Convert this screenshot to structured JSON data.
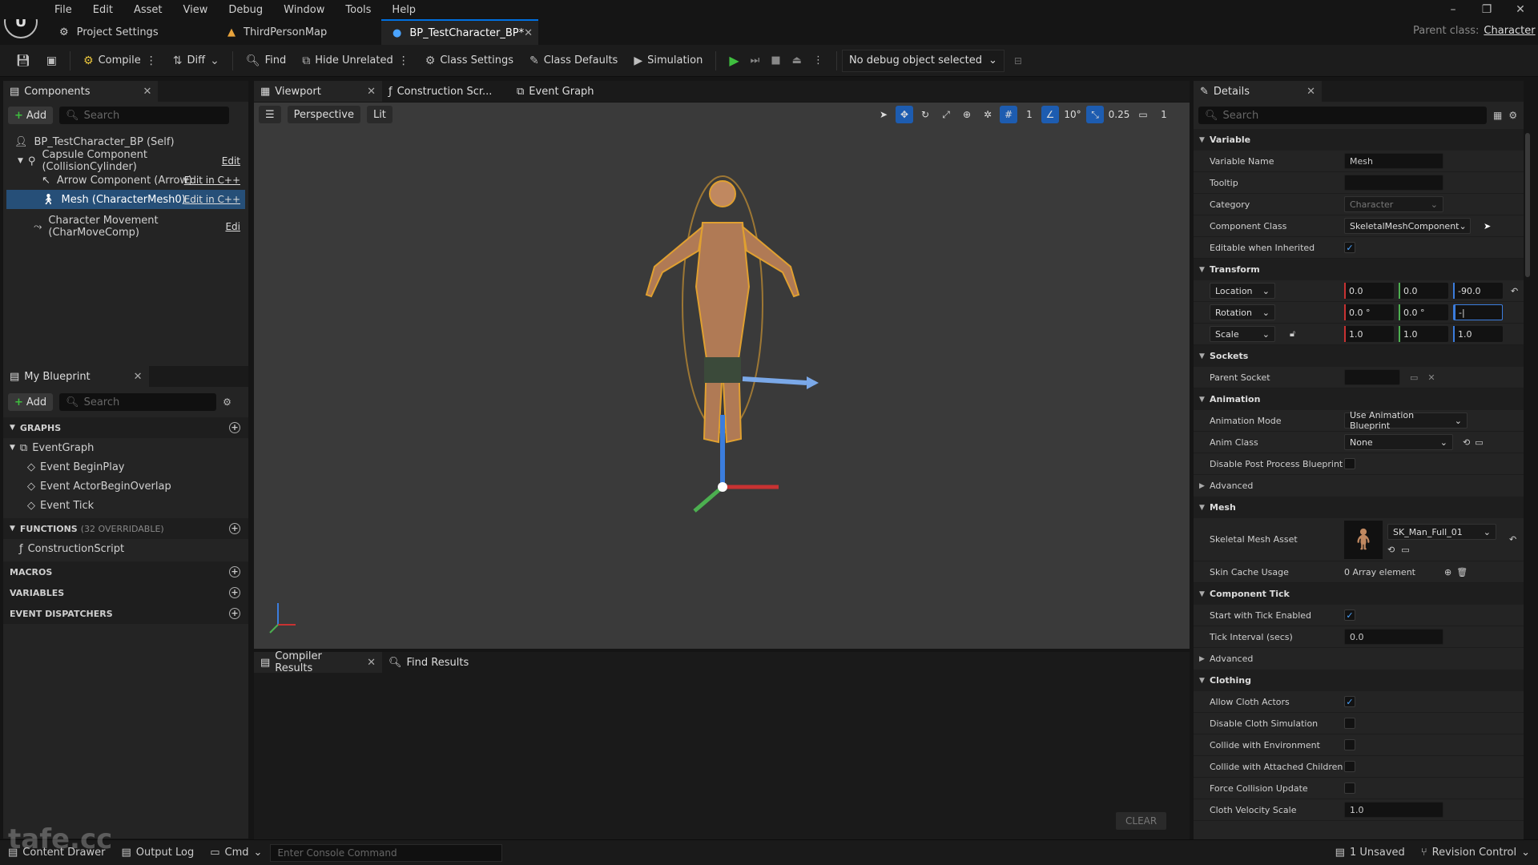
{
  "menu": [
    "File",
    "Edit",
    "Asset",
    "View",
    "Debug",
    "Window",
    "Tools",
    "Help"
  ],
  "tabs": [
    {
      "label": "Project Settings",
      "active": false
    },
    {
      "label": "ThirdPersonMap",
      "active": false
    },
    {
      "label": "BP_TestCharacter_BP*",
      "active": true
    }
  ],
  "parent_class": {
    "label": "Parent class:",
    "value": "Character"
  },
  "toolbar": {
    "compile": "Compile",
    "diff": "Diff",
    "find": "Find",
    "hide_unrelated": "Hide Unrelated",
    "class_settings": "Class Settings",
    "class_defaults": "Class Defaults",
    "simulation": "Simulation",
    "debug_object": "No debug object selected"
  },
  "components": {
    "title": "Components",
    "add": "Add",
    "search_placeholder": "Search",
    "items": [
      {
        "label": "BP_TestCharacter_BP (Self)",
        "edit": ""
      },
      {
        "label": "Capsule Component (CollisionCylinder)",
        "edit": "Edit"
      },
      {
        "label": "Arrow Component (Arrow)",
        "edit": "Edit in C++"
      },
      {
        "label": "Mesh (CharacterMesh0)",
        "edit": "Edit in C++"
      },
      {
        "label": "Character Movement (CharMoveComp)",
        "edit": "Edi"
      }
    ]
  },
  "my_blueprint": {
    "title": "My Blueprint",
    "add": "Add",
    "search_placeholder": "Search",
    "graphs_label": "GRAPHS",
    "event_graph": "EventGraph",
    "events": [
      "Event BeginPlay",
      "Event ActorBeginOverlap",
      "Event Tick"
    ],
    "functions_label": "FUNCTIONS",
    "functions_count": "(32 OVERRIDABLE)",
    "construction_script": "ConstructionScript",
    "macros": "MACROS",
    "variables": "VARIABLES",
    "event_dispatchers": "EVENT DISPATCHERS"
  },
  "editor_tabs": [
    "Viewport",
    "Construction Scr...",
    "Event Graph"
  ],
  "viewport": {
    "perspective": "Perspective",
    "lit": "Lit",
    "grid": "1",
    "angle": "10°",
    "scale": "0.25",
    "camera": "1"
  },
  "bottom_tabs": [
    "Compiler Results",
    "Find Results"
  ],
  "clear_label": "CLEAR",
  "details": {
    "title": "Details",
    "search_placeholder": "Search",
    "variable": {
      "section": "Variable",
      "variable_name_label": "Variable Name",
      "variable_name": "Mesh",
      "tooltip_label": "Tooltip",
      "category_label": "Category",
      "category": "Character",
      "component_class_label": "Component Class",
      "component_class": "SkeletalMeshComponent",
      "editable_label": "Editable when Inherited"
    },
    "transform": {
      "section": "Transform",
      "location_label": "Location",
      "location": [
        "0.0",
        "0.0",
        "-90.0"
      ],
      "rotation_label": "Rotation",
      "rotation": [
        "0.0 °",
        "0.0 °",
        "-|"
      ],
      "scale_label": "Scale",
      "scale": [
        "1.0",
        "1.0",
        "1.0"
      ]
    },
    "sockets": {
      "section": "Sockets",
      "parent_socket_label": "Parent Socket"
    },
    "animation": {
      "section": "Animation",
      "mode_label": "Animation Mode",
      "mode": "Use Animation Blueprint",
      "anim_class_label": "Anim Class",
      "anim_class": "None",
      "disable_pp_label": "Disable Post Process Blueprint",
      "advanced": "Advanced"
    },
    "mesh": {
      "section": "Mesh",
      "asset_label": "Skeletal Mesh Asset",
      "asset": "SK_Man_Full_01",
      "skin_cache_label": "Skin Cache Usage",
      "skin_cache": "0 Array element"
    },
    "component_tick": {
      "section": "Component Tick",
      "start_label": "Start with Tick Enabled",
      "interval_label": "Tick Interval (secs)",
      "interval": "0.0",
      "advanced": "Advanced"
    },
    "clothing": {
      "section": "Clothing",
      "rows": [
        {
          "label": "Allow Cloth Actors",
          "checked": true
        },
        {
          "label": "Disable Cloth Simulation",
          "checked": false
        },
        {
          "label": "Collide with Environment",
          "checked": false
        },
        {
          "label": "Collide with Attached Children",
          "checked": false
        },
        {
          "label": "Force Collision Update",
          "checked": false
        }
      ],
      "velocity_label": "Cloth Velocity Scale",
      "velocity": "1.0"
    }
  },
  "statusbar": {
    "content_drawer": "Content Drawer",
    "output_log": "Output Log",
    "cmd": "Cmd",
    "console_placeholder": "Enter Console Command",
    "unsaved": "1 Unsaved",
    "revision": "Revision Control"
  },
  "watermark": "tafe.cc",
  "colors": {
    "accent": "#0070e0",
    "selection": "#264f78",
    "play": "#3fbf3f"
  }
}
